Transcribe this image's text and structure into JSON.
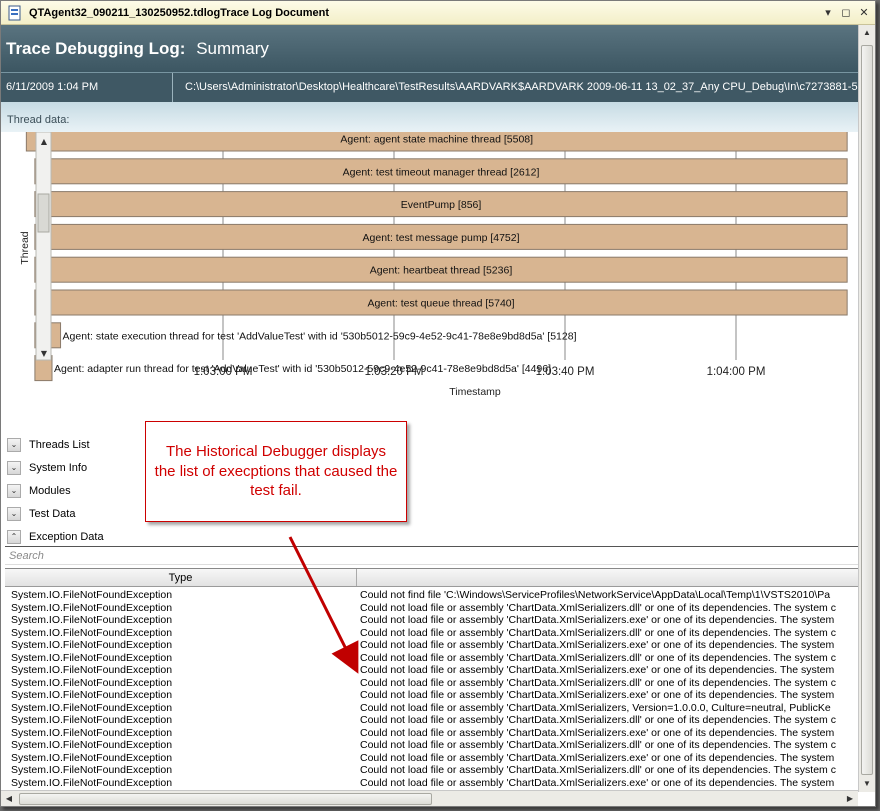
{
  "window": {
    "title": "QTAgent32_090211_130250952.tdlogTrace Log Document",
    "min_glyph": "▾",
    "restore_glyph": "◻",
    "close_glyph": "✕"
  },
  "header": {
    "title": "Trace Debugging Log:",
    "subtitle": "Summary"
  },
  "infobar": {
    "date": "6/11/2009 1:04 PM",
    "path": "C:\\Users\\Administrator\\Desktop\\Healthcare\\TestResults\\AARDVARK$AARDVARK 2009-06-11 13_02_37_Any CPU_Debug\\In\\c7273881-5"
  },
  "thread_data_label": "Thread data:",
  "chart_data": {
    "type": "bar",
    "ylabel": "Thread",
    "xlabel": "Timestamp",
    "x_ticks": [
      "1:03:00 PM",
      "1:03:20 PM",
      "1:03:40 PM",
      "1:04:00 PM"
    ],
    "threads": [
      {
        "name": "Agent: agent state machine thread [5508]",
        "start": "1:02:37 PM",
        "end": "1:04:13 PM"
      },
      {
        "name": "Agent: test timeout manager thread [2612]",
        "start": "1:02:38 PM",
        "end": "1:04:13 PM"
      },
      {
        "name": "EventPump [856]",
        "start": "1:02:38 PM",
        "end": "1:04:13 PM"
      },
      {
        "name": "Agent: test message pump [4752]",
        "start": "1:02:38 PM",
        "end": "1:04:13 PM"
      },
      {
        "name": "Agent: heartbeat thread [5236]",
        "start": "1:02:38 PM",
        "end": "1:04:13 PM"
      },
      {
        "name": "Agent: test queue thread [5740]",
        "start": "1:02:38 PM",
        "end": "1:04:13 PM"
      },
      {
        "name": "Agent: state execution thread for test 'AddValueTest' with id '530b5012-59c9-4e52-9c41-78e8e9bd8d5a' [5128]",
        "start": "1:02:38 PM",
        "end": "1:02:41 PM"
      },
      {
        "name": "Agent: adapter run thread for test 'AddValueTest' with id '530b5012-59c9-4e52-9c41-78e8e9bd8d5a' [4496]",
        "start": "1:02:38 PM",
        "end": "1:02:40 PM"
      }
    ],
    "bar_color": "#d8b591",
    "grid": true
  },
  "sections": [
    {
      "label": "Threads List",
      "toggle": "⌄"
    },
    {
      "label": "System Info",
      "toggle": "⌄"
    },
    {
      "label": "Modules",
      "toggle": "⌄"
    },
    {
      "label": "Test Data",
      "toggle": "⌄"
    },
    {
      "label": "Exception Data",
      "toggle": "⌃"
    }
  ],
  "callout": {
    "text": "The Historical Debugger displays the list of execptions that caused the test fail."
  },
  "search": {
    "placeholder": "Search"
  },
  "grid": {
    "columns": [
      "Type",
      ""
    ],
    "rows": [
      {
        "type": "System.IO.FileNotFoundException",
        "message": "Could not find file 'C:\\Windows\\ServiceProfiles\\NetworkService\\AppData\\Local\\Temp\\1\\VSTS2010\\Pa"
      },
      {
        "type": "System.IO.FileNotFoundException",
        "message": "Could not load file or assembly 'ChartData.XmlSerializers.dll' or one of its dependencies. The system c"
      },
      {
        "type": "System.IO.FileNotFoundException",
        "message": "Could not load file or assembly 'ChartData.XmlSerializers.exe' or one of its dependencies. The system"
      },
      {
        "type": "System.IO.FileNotFoundException",
        "message": "Could not load file or assembly 'ChartData.XmlSerializers.dll' or one of its dependencies. The system c"
      },
      {
        "type": "System.IO.FileNotFoundException",
        "message": "Could not load file or assembly 'ChartData.XmlSerializers.exe' or one of its dependencies. The system"
      },
      {
        "type": "System.IO.FileNotFoundException",
        "message": "Could not load file or assembly 'ChartData.XmlSerializers.dll' or one of its dependencies. The system c"
      },
      {
        "type": "System.IO.FileNotFoundException",
        "message": "Could not load file or assembly 'ChartData.XmlSerializers.exe' or one of its dependencies. The system"
      },
      {
        "type": "System.IO.FileNotFoundException",
        "message": "Could not load file or assembly 'ChartData.XmlSerializers.dll' or one of its dependencies. The system c"
      },
      {
        "type": "System.IO.FileNotFoundException",
        "message": "Could not load file or assembly 'ChartData.XmlSerializers.exe' or one of its dependencies. The system"
      },
      {
        "type": "System.IO.FileNotFoundException",
        "message": "Could not load file or assembly 'ChartData.XmlSerializers, Version=1.0.0.0, Culture=neutral, PublicKe"
      },
      {
        "type": "System.IO.FileNotFoundException",
        "message": "Could not load file or assembly 'ChartData.XmlSerializers.dll' or one of its dependencies. The system c"
      },
      {
        "type": "System.IO.FileNotFoundException",
        "message": "Could not load file or assembly 'ChartData.XmlSerializers.exe' or one of its dependencies. The system"
      },
      {
        "type": "System.IO.FileNotFoundException",
        "message": "Could not load file or assembly 'ChartData.XmlSerializers.dll' or one of its dependencies. The system c"
      },
      {
        "type": "System.IO.FileNotFoundException",
        "message": "Could not load file or assembly 'ChartData.XmlSerializers.exe' or one of its dependencies. The system"
      },
      {
        "type": "System.IO.FileNotFoundException",
        "message": "Could not load file or assembly 'ChartData.XmlSerializers.dll' or one of its dependencies. The system c"
      },
      {
        "type": "System.IO.FileNotFoundException",
        "message": "Could not load file or assembly 'ChartData.XmlSerializers.exe' or one of its dependencies. The system"
      }
    ]
  },
  "scroll": {
    "up": "▲",
    "down": "▼",
    "left": "◀",
    "right": "▶"
  }
}
